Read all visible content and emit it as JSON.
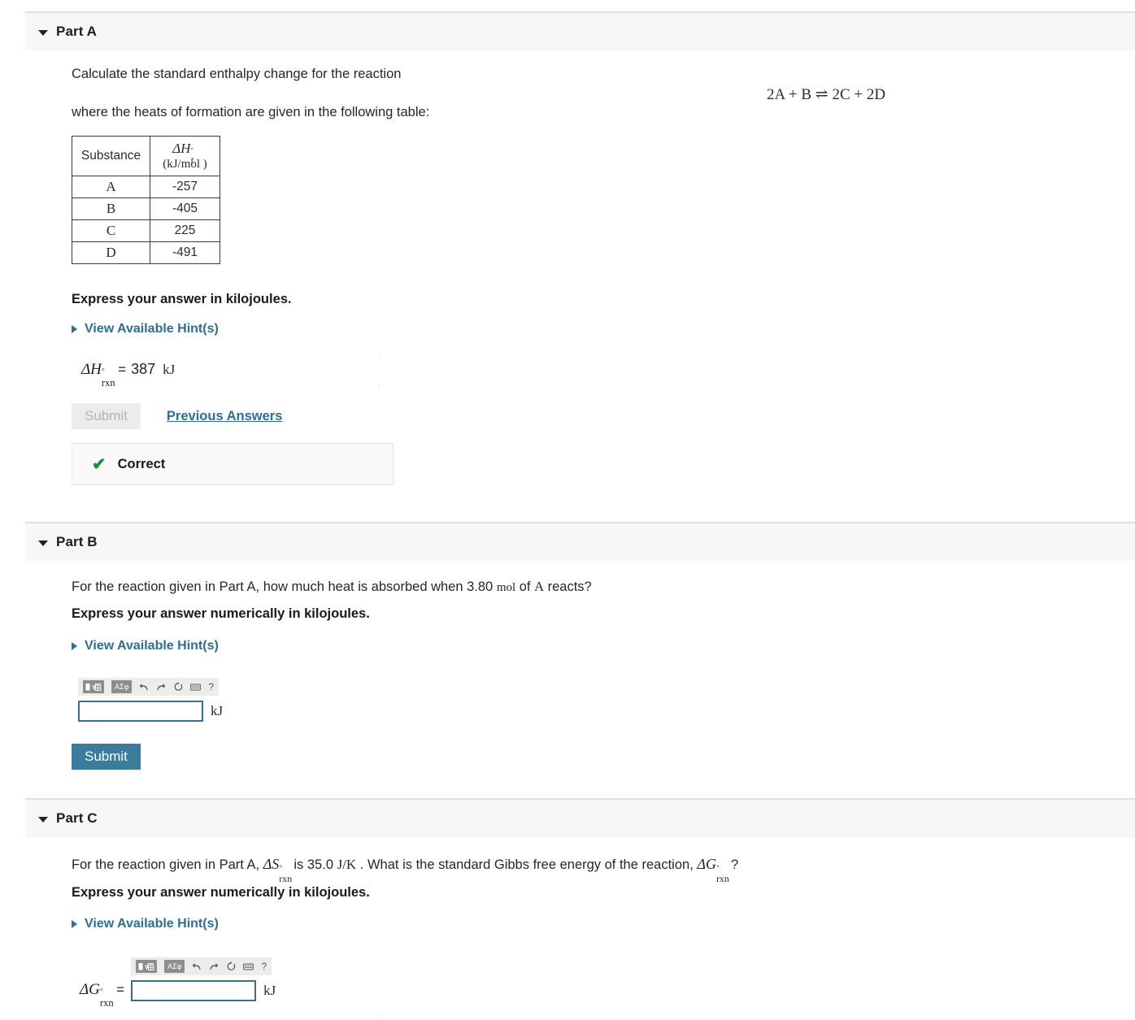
{
  "parts": {
    "a": {
      "title": "Part A",
      "prompt_line1": "Calculate the standard enthalpy change for the reaction",
      "prompt_line2": "where the heats of formation are given in the following table:",
      "equation": "2A + B ⇌ 2C + 2D",
      "table": {
        "headers": [
          "Substance",
          "ΔH°f",
          "(kJ/mol  )"
        ],
        "rows": [
          {
            "substance": "A",
            "value": "-257"
          },
          {
            "substance": "B",
            "value": "-405"
          },
          {
            "substance": "C",
            "value": "225"
          },
          {
            "substance": "D",
            "value": "-491"
          }
        ]
      },
      "instruction": "Express your answer in kilojoules.",
      "hint_label": "View Available Hint(s)",
      "answer": {
        "symbol_delta": "Δ",
        "symbol_var": "H",
        "symbol_sup": "○",
        "symbol_sub": "rxn",
        "equals": "=",
        "value": "387",
        "unit": "kJ"
      },
      "submit_label": "Submit",
      "previous_answers_label": "Previous Answers",
      "feedback": {
        "icon": "check-icon",
        "label": "Correct"
      }
    },
    "b": {
      "title": "Part B",
      "question_pre": "For the reaction given in Part A, how much heat is absorbed when 3.80 ",
      "question_unit": "mol",
      "question_mid": " of ",
      "question_species": "A",
      "question_post": " reacts?",
      "instruction": "Express your answer numerically in kilojoules.",
      "hint_label": "View Available Hint(s)",
      "input_value": "",
      "unit": "kJ",
      "submit_label": "Submit"
    },
    "c": {
      "title": "Part C",
      "question_pre": "For the reaction given in Part A, ",
      "entropy_delta": "Δ",
      "entropy_var": "S",
      "entropy_sup": "○",
      "entropy_sub": "rxn",
      "question_mid1": " is 35.0 ",
      "entropy_unit": "J/K",
      "question_mid2": " . What is the standard Gibbs free energy of the reaction, ",
      "gibbs_delta": "Δ",
      "gibbs_var": "G",
      "gibbs_sup": "○",
      "gibbs_sub": "rxn",
      "question_post": " ?",
      "instruction": "Express your answer numerically in kilojoules.",
      "hint_label": "View Available Hint(s)",
      "answer_label_delta": "Δ",
      "answer_label_var": "G",
      "answer_label_sup": "○",
      "answer_label_sub": "rxn",
      "equals": "=",
      "input_value": "",
      "unit": "kJ"
    }
  },
  "answer_toolbar": {
    "buttons": [
      {
        "name": "math-template-icon",
        "glyph": "▣√▤"
      },
      {
        "name": "greek-symbols-icon",
        "glyph": "ΑΣφ"
      }
    ],
    "icons": [
      {
        "name": "undo-icon",
        "glyph": "↰"
      },
      {
        "name": "redo-icon",
        "glyph": "↱"
      },
      {
        "name": "reset-icon",
        "glyph": "↻"
      },
      {
        "name": "keyboard-icon",
        "glyph": "▭"
      },
      {
        "name": "help-icon",
        "glyph": "?"
      }
    ]
  },
  "colors": {
    "accent": "#3b7c9e",
    "link": "#2c6f93",
    "correct": "#1e8b3e",
    "header_band": "#f7f7f7",
    "input_border": "#36708f"
  }
}
